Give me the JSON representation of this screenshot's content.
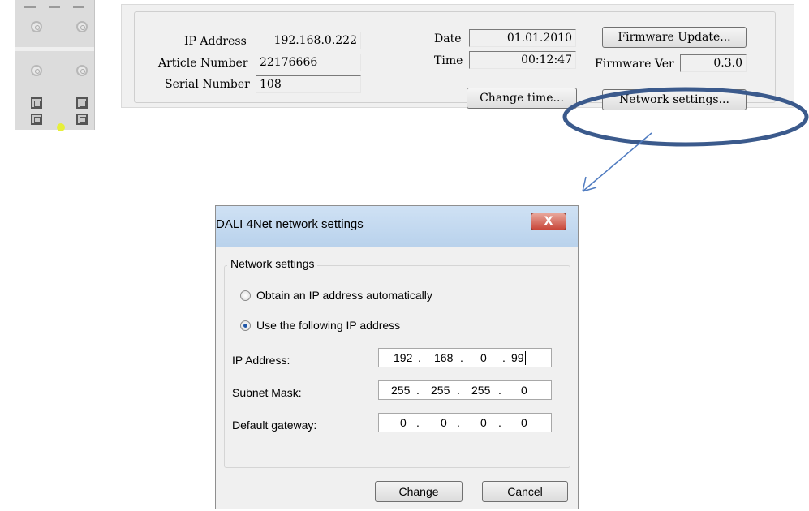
{
  "device": {
    "name": "device-image"
  },
  "info": {
    "ip_label": "IP Address",
    "ip_value": "192.168.0.222",
    "article_label": "Article Number",
    "article_value": "22176666",
    "serial_label": "Serial Number",
    "serial_value": "108",
    "date_label": "Date",
    "date_value": "01.01.2010",
    "time_label": "Time",
    "time_value": "00:12:47",
    "firmware_update_label": "Firmware Update...",
    "firmware_ver_label": "Firmware Ver",
    "firmware_ver_value": "0.3.0",
    "change_time_label": "Change time...",
    "network_settings_label": "Network settings..."
  },
  "annotation": {
    "color": "#3b5a8c",
    "icons": [
      "ellipse-highlight",
      "arrow-icon"
    ]
  },
  "dialog": {
    "title": "DALI 4Net network settings",
    "close_glyph": "X",
    "group_label": "Network settings",
    "radio_auto_label": "Obtain an IP address automatically",
    "radio_manual_label": "Use the following IP address",
    "selected_mode": "manual",
    "ip_label": "IP Address:",
    "ip": [
      "192",
      "168",
      "0",
      "99"
    ],
    "subnet_label": "Subnet Mask:",
    "subnet": [
      "255",
      "255",
      "255",
      "0"
    ],
    "gateway_label": "Default gateway:",
    "gateway": [
      "0",
      "0",
      "0",
      "0"
    ],
    "change_label": "Change",
    "cancel_label": "Cancel"
  },
  "colors": {
    "titlebar": "#c5dbf1",
    "close": "#c9473a",
    "radio_dot": "#1f56a8",
    "panel": "#f0f0f0"
  }
}
